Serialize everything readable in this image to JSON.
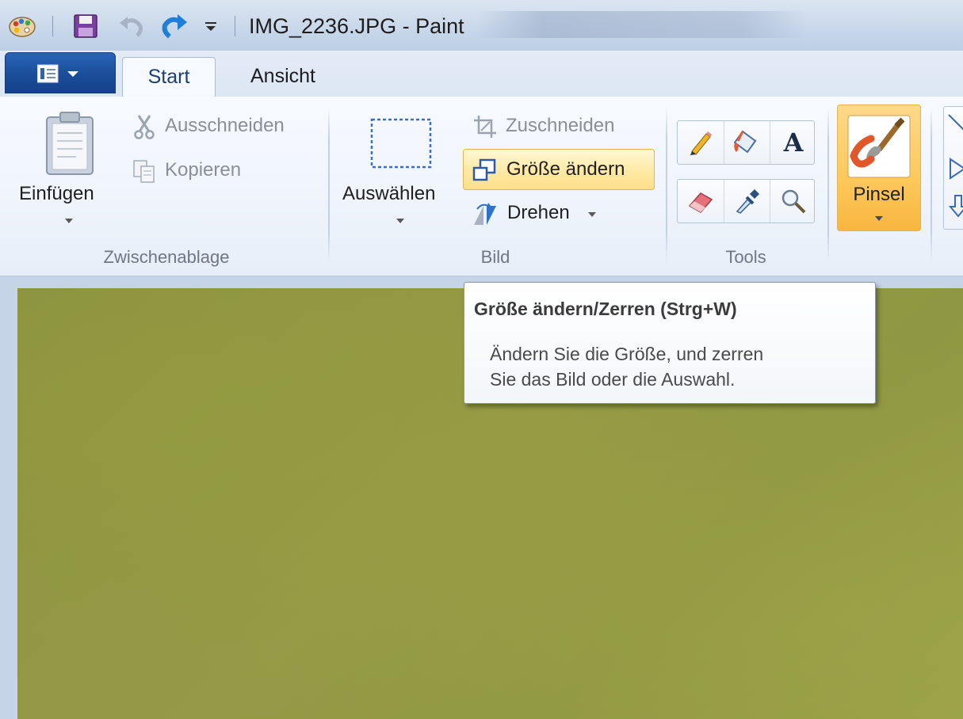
{
  "window": {
    "title": "IMG_2236.JPG - Paint",
    "app": "Paint"
  },
  "quick_access": {
    "icons": [
      "paint-app-icon",
      "save-icon",
      "undo-icon",
      "redo-icon",
      "customize-dropdown-icon"
    ]
  },
  "tabs": [
    {
      "label": "Start",
      "active": true
    },
    {
      "label": "Ansicht",
      "active": false
    }
  ],
  "groups": {
    "clipboard": {
      "label": "Zwischenablage",
      "paste": "Einfügen",
      "cut": "Ausschneiden",
      "copy": "Kopieren"
    },
    "image": {
      "label": "Bild",
      "select": "Auswählen",
      "crop": "Zuschneiden",
      "resize": "Größe ändern",
      "rotate": "Drehen"
    },
    "tools": {
      "label": "Tools",
      "items": [
        "pencil-icon",
        "fill-bucket-icon",
        "text-icon",
        "eraser-icon",
        "color-picker-icon",
        "magnifier-icon"
      ]
    },
    "brushes": {
      "label": "Pinsel"
    }
  },
  "tooltip": {
    "title": "Größe ändern/Zerren (Strg+W)",
    "line1": "Ändern Sie die Größe, und zerren",
    "line2": "Sie das Bild oder die Auswahl."
  },
  "colors": {
    "canvas": "#949a45",
    "highlight": "#ffe08a",
    "app_menu": "#1b4f9c"
  }
}
